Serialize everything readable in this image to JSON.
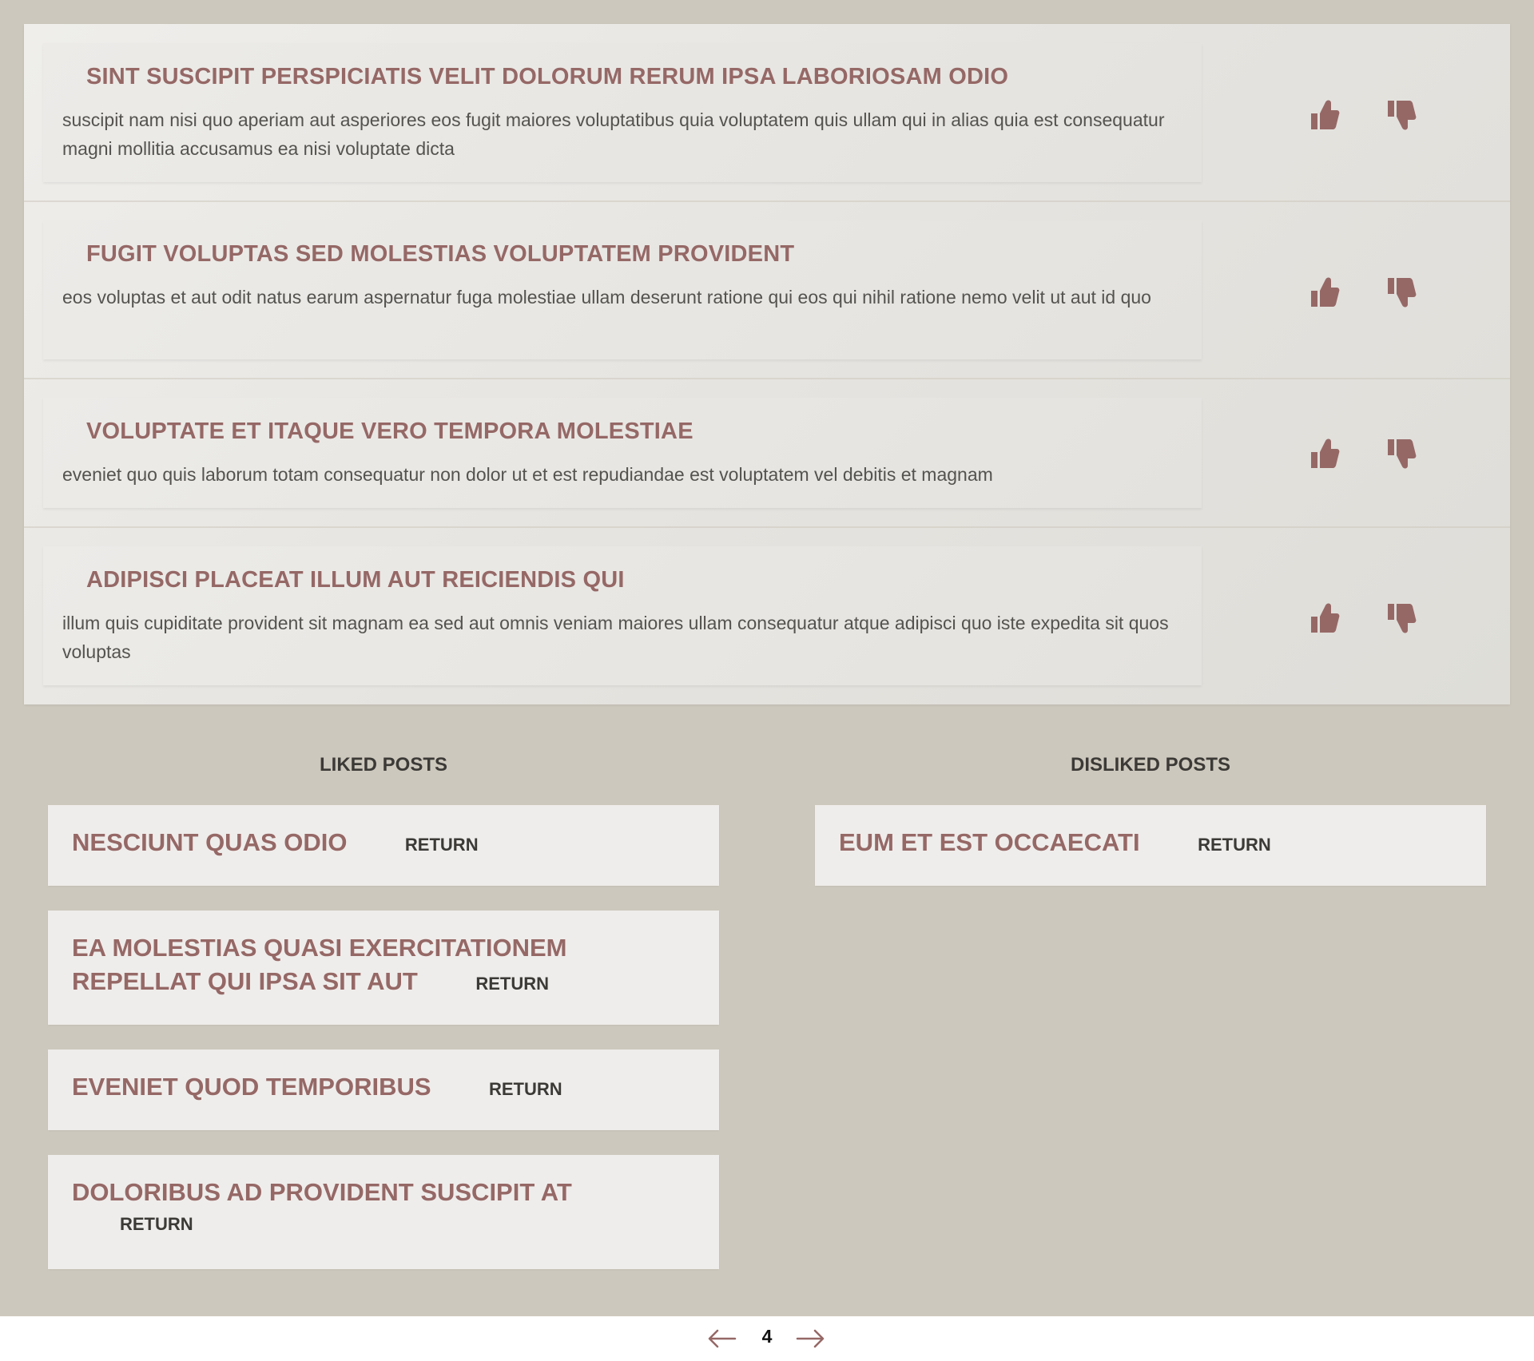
{
  "colors": {
    "accent": "#956866",
    "background": "#cdc8bd",
    "card": "#efedeb",
    "text": "#555350"
  },
  "posts": [
    {
      "title": "SINT SUSCIPIT PERSPICIATIS VELIT DOLORUM RERUM IPSA LABORIOSAM ODIO",
      "body": "suscipit nam nisi quo aperiam aut asperiores eos fugit maiores voluptatibus quia voluptatem quis ullam qui in alias quia est consequatur magni mollitia accusamus ea nisi voluptate dicta",
      "like_icon": "thumbs-up-icon",
      "dislike_icon": "thumbs-down-icon"
    },
    {
      "title": "FUGIT VOLUPTAS SED MOLESTIAS VOLUPTATEM PROVIDENT",
      "body": "eos voluptas et aut odit natus earum aspernatur fuga molestiae ullam deserunt ratione qui eos qui nihil ratione nemo velit ut aut id quo",
      "like_icon": "thumbs-up-icon",
      "dislike_icon": "thumbs-down-icon"
    },
    {
      "title": "VOLUPTATE ET ITAQUE VERO TEMPORA MOLESTIAE",
      "body": "eveniet quo quis laborum totam consequatur non dolor ut et est repudiandae est voluptatem vel debitis et magnam",
      "like_icon": "thumbs-up-icon",
      "dislike_icon": "thumbs-down-icon"
    },
    {
      "title": "ADIPISCI PLACEAT ILLUM AUT REICIENDIS QUI",
      "body": "illum quis cupiditate provident sit magnam ea sed aut omnis veniam maiores ullam consequatur atque adipisci quo iste expedita sit quos voluptas",
      "like_icon": "thumbs-up-icon",
      "dislike_icon": "thumbs-down-icon"
    }
  ],
  "liked": {
    "heading": "LIKED POSTS",
    "items": [
      {
        "title": "NESCIUNT QUAS ODIO",
        "action": "RETURN"
      },
      {
        "title": "EA MOLESTIAS QUASI EXERCITATIONEM REPELLAT QUI IPSA SIT AUT",
        "action": "RETURN"
      },
      {
        "title": "EVENIET QUOD TEMPORIBUS",
        "action": "RETURN"
      },
      {
        "title": "DOLORIBUS AD PROVIDENT SUSCIPIT AT",
        "action": "RETURN"
      }
    ]
  },
  "disliked": {
    "heading": "DISLIKED POSTS",
    "items": [
      {
        "title": "EUM ET EST OCCAECATI",
        "action": "RETURN"
      }
    ]
  },
  "pagination": {
    "current_page": "4",
    "prev_icon": "arrow-left-icon",
    "next_icon": "arrow-right-icon"
  }
}
